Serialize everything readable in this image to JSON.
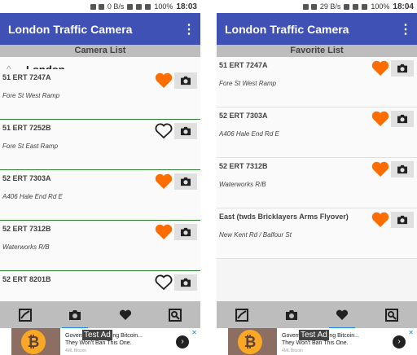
{
  "left": {
    "status": {
      "net_speed": "0 B/s",
      "battery": "100%",
      "time": "18:03"
    },
    "app_title": "London Traffic Camera",
    "sub_header": "Camera List",
    "group": "London",
    "rows": [
      {
        "code": "51 ERT 7247A",
        "location": "Fore St West Ramp",
        "favorite": true
      },
      {
        "code": "51 ERT 7252B",
        "location": "Fore St East Ramp",
        "favorite": false
      },
      {
        "code": "52 ERT 7303A",
        "location": "A406 Hale End Rd E",
        "favorite": true
      },
      {
        "code": "52 ERT 7312B",
        "location": "Waterworks R/B",
        "favorite": true
      },
      {
        "code": "52 ERT 8201B",
        "location": "",
        "favorite": false
      }
    ],
    "active_tab": "camera"
  },
  "right": {
    "status": {
      "net_speed": "29 B/s",
      "battery": "100%",
      "time": "18:04"
    },
    "app_title": "London Traffic Camera",
    "sub_header": "Favorite List",
    "rows": [
      {
        "code": "51 ERT 7247A",
        "location": "Fore St West Ramp",
        "favorite": true
      },
      {
        "code": "52 ERT 7303A",
        "location": "A406 Hale End Rd E",
        "favorite": true
      },
      {
        "code": "52 ERT 7312B",
        "location": "Waterworks R/B",
        "favorite": true
      },
      {
        "code": "East (twds Bricklayers Arms Flyover)",
        "location": "New Kent Rd / Balfour St",
        "favorite": true
      }
    ],
    "active_tab": "favorite"
  },
  "ad": {
    "tag": "Test Ad",
    "line1": "Government Banning Bitcoin...",
    "line2": "They Won't Ban This One.",
    "line3": "4ML Bitcoin",
    "coin": "₿"
  },
  "colors": {
    "app_bar": "#3f51b5",
    "heart_fill": "#ff6d00",
    "divider": "#2e7d32"
  },
  "icons": {
    "row_buttons": [
      "heart-icon",
      "camera-icon"
    ],
    "bottom_nav": [
      "map-icon",
      "camera-icon",
      "heart-icon",
      "search-image-icon"
    ]
  }
}
